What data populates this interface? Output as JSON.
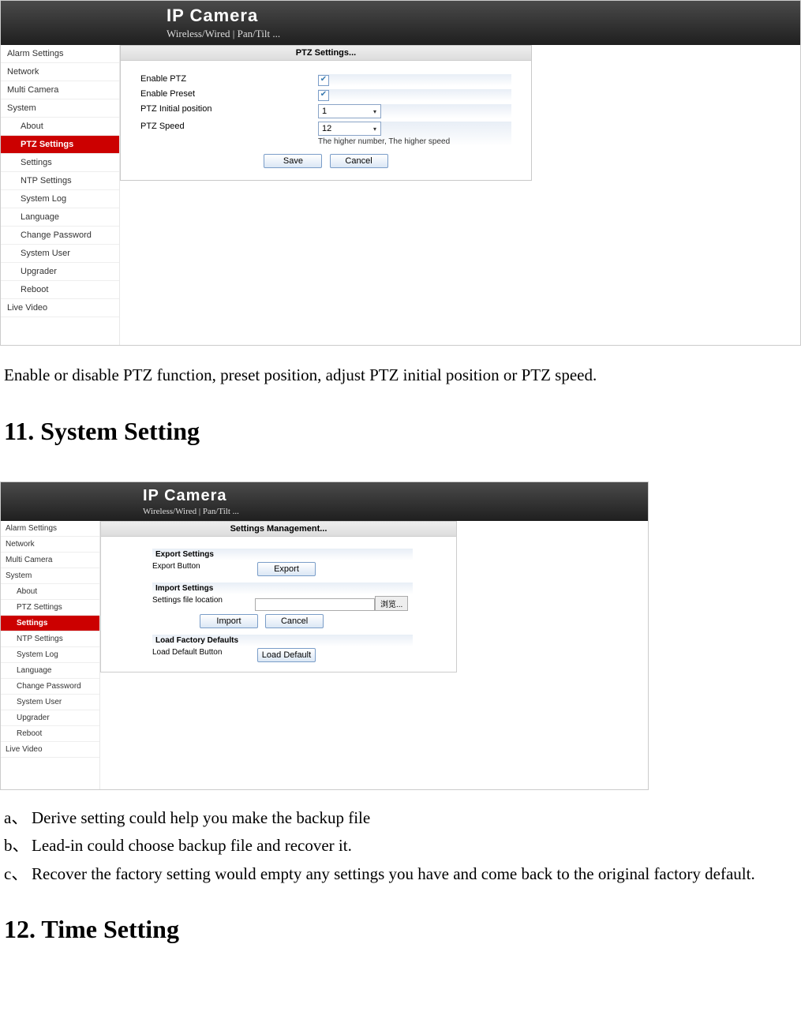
{
  "header": {
    "title": "IP Camera",
    "subtitle": "Wireless/Wired | Pan/Tilt ..."
  },
  "sidebar": {
    "alarm": "Alarm Settings",
    "network": "Network",
    "multi": "Multi Camera",
    "system": "System",
    "about": "About",
    "ptz": "PTZ Settings",
    "settings": "Settings",
    "ntp": "NTP Settings",
    "syslog": "System Log",
    "language": "Language",
    "changepw": "Change Password",
    "sysuser": "System User",
    "upgrader": "Upgrader",
    "reboot": "Reboot",
    "live": "Live Video"
  },
  "ptz_panel": {
    "title": "PTZ Settings...",
    "enable_ptz": "Enable PTZ",
    "enable_preset": "Enable Preset",
    "initial_pos": "PTZ Initial position",
    "initial_pos_value": "1",
    "speed": "PTZ Speed",
    "speed_value": "12",
    "speed_hint": "The higher number, The higher speed",
    "save": "Save",
    "cancel": "Cancel",
    "check": "✔"
  },
  "doc": {
    "ptz_desc": "Enable or disable PTZ function, preset position, adjust PTZ initial position or PTZ speed.",
    "heading11": "11. System Setting",
    "heading12": "12. Time Setting",
    "marker_a": "a、",
    "marker_b": "b、",
    "marker_c": "c、",
    "item_a": "Derive setting could help you make the backup file",
    "item_b": "Lead-in could choose backup file and recover it.",
    "item_c": "Recover the factory setting would empty any settings you have and come back to the original factory default."
  },
  "settings_panel": {
    "title": "Settings Management...",
    "export_title": "Export Settings",
    "export_label": "Export Button",
    "export_btn": "Export",
    "import_title": "Import Settings",
    "import_label": "Settings file location",
    "browse": "浏览...",
    "import_btn": "Import",
    "cancel_btn": "Cancel",
    "factory_title": "Load Factory Defaults",
    "factory_label": "Load Default Button",
    "factory_btn": "Load Default"
  }
}
